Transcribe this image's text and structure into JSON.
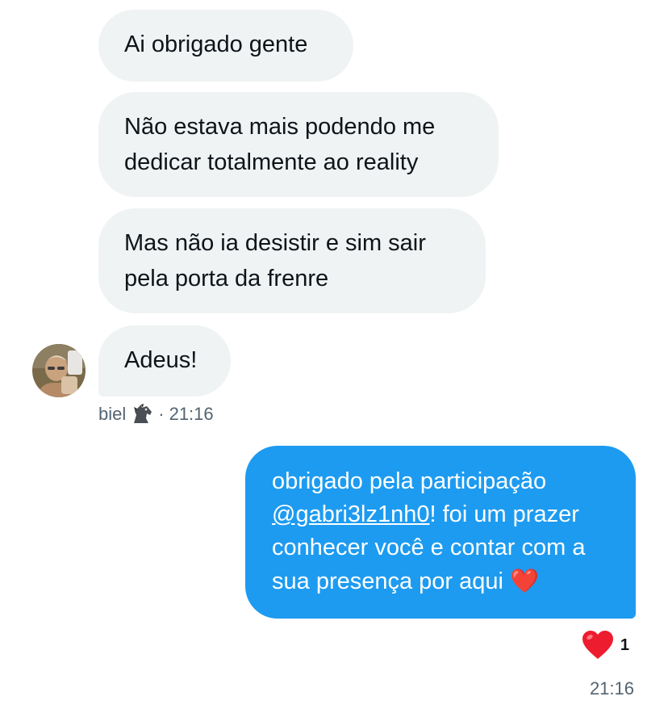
{
  "incoming": {
    "messages": [
      "Ai obrigado gente",
      "Não estava mais podendo me dedicar totalmente ao reality",
      "Mas não ia desistir e sim sair pela porta da frenre",
      "Adeus!"
    ],
    "sender": "biel",
    "sender_badge_icon": "horse-emoji",
    "separator": "·",
    "time": "21:16"
  },
  "outgoing": {
    "text_before": "obrigado pela participação ",
    "mention": "@gabri3lz1nh0",
    "text_after": "! foi um prazer conhecer você e contar com a sua presença por aqui ",
    "emoji": "❤️",
    "reaction_emoji": "❤️",
    "reaction_count": "1",
    "time": "21:16",
    "bubble_color": "#1d9bf0"
  },
  "colors": {
    "incoming_bubble": "#eff3f4",
    "meta_text": "#536471"
  }
}
